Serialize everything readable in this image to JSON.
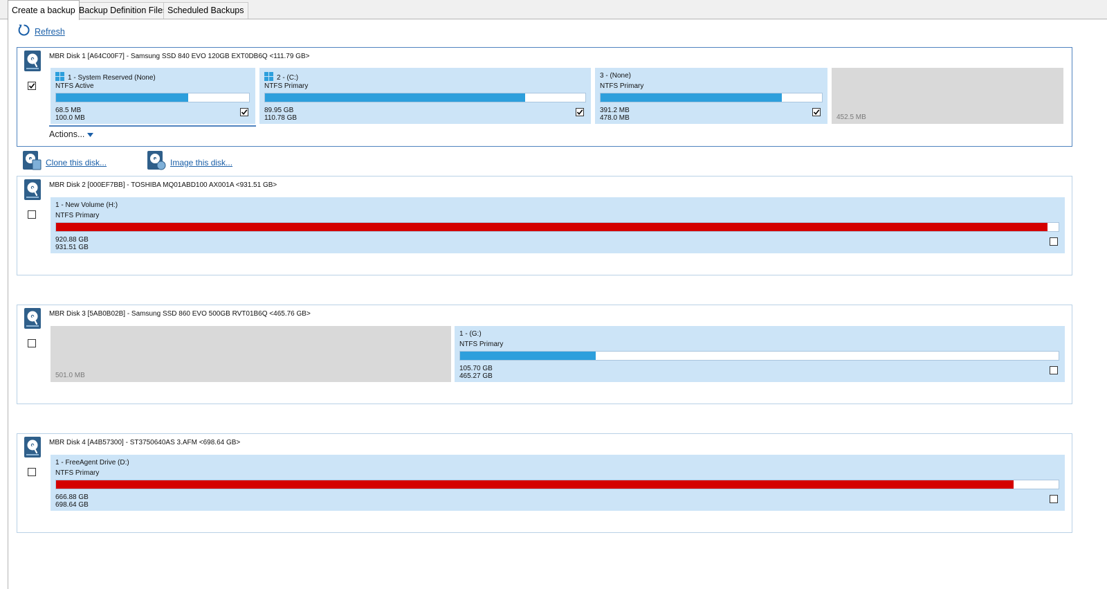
{
  "tabs": [
    "Create a backup",
    "Backup Definition Files",
    "Scheduled Backups"
  ],
  "refresh_label": "Refresh",
  "disk_links": {
    "clone": "Clone this disk...",
    "image": "Image this disk..."
  },
  "actions_label": "Actions...",
  "colors": {
    "used_ok": "#2d9fdc",
    "used_full": "#d40000",
    "partition_bg": "#cce4f7",
    "unallocated_bg": "#d9d9d9",
    "selected_border": "#4f83bf"
  },
  "disks": [
    {
      "title": "MBR Disk 1 [A64C00F7] - Samsung SSD 840 EVO 120GB EXT0DB6Q  <111.79 GB>",
      "checked": true,
      "partitions": [
        {
          "name": "1 - System Reserved (None)",
          "type": "NTFS Active",
          "used": "68.5 MB",
          "total": "100.0 MB",
          "used_fraction": 0.685,
          "checked": true,
          "windows_icon": true
        },
        {
          "name": "2 -  (C:)",
          "type": "NTFS Primary",
          "used": "89.95 GB",
          "total": "110.78 GB",
          "used_fraction": 0.812,
          "checked": true,
          "windows_icon": true
        },
        {
          "name": "3 -  (None)",
          "type": "NTFS Primary",
          "used": "391.2 MB",
          "total": "478.0 MB",
          "used_fraction": 0.818,
          "checked": true,
          "windows_icon": false
        },
        {
          "unallocated": true,
          "size": "452.5 MB"
        }
      ]
    },
    {
      "title": "MBR Disk 2 [000EF7BB] - TOSHIBA MQ01ABD100 AX001A  <931.51 GB>",
      "checked": false,
      "partitions": [
        {
          "name": "1 - New Volume (H:)",
          "type": "NTFS Primary",
          "used": "920.88 GB",
          "total": "931.51 GB",
          "used_fraction": 0.989,
          "checked": false,
          "windows_icon": false
        }
      ]
    },
    {
      "title": "MBR Disk 3 [5AB0B02B] - Samsung SSD 860 EVO 500GB RVT01B6Q  <465.76 GB>",
      "checked": false,
      "partitions": [
        {
          "unallocated": true,
          "size": "501.0 MB"
        },
        {
          "name": "1 -  (G:)",
          "type": "NTFS Primary",
          "used": "105.70 GB",
          "total": "465.27 GB",
          "used_fraction": 0.227,
          "checked": false,
          "windows_icon": false
        }
      ]
    },
    {
      "title": "MBR Disk 4 [A4B57300] - ST3750640AS 3.AFM  <698.64 GB>",
      "checked": false,
      "partitions": [
        {
          "name": "1 - FreeAgent Drive (D:)",
          "type": "NTFS Primary",
          "used": "666.88 GB",
          "total": "698.64 GB",
          "used_fraction": 0.955,
          "checked": false,
          "windows_icon": false
        }
      ]
    }
  ]
}
